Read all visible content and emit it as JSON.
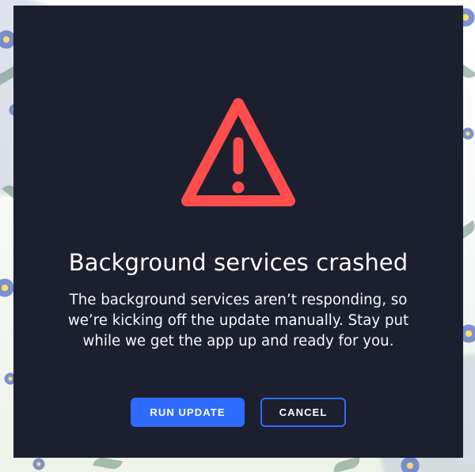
{
  "dialog": {
    "title": "Background services crashed",
    "message": "The background services aren’t responding, so we’re kicking off the update manually. Stay put while we get the app up and ready for you.",
    "warning_icon": "warning-icon",
    "primary_action": "RUN UPDATE",
    "secondary_action": "CANCEL"
  },
  "colors": {
    "modal_background": "#1c1f2e",
    "accent": "#2d6cff",
    "warning": "#ff4d4d",
    "text": "#ffffff"
  }
}
